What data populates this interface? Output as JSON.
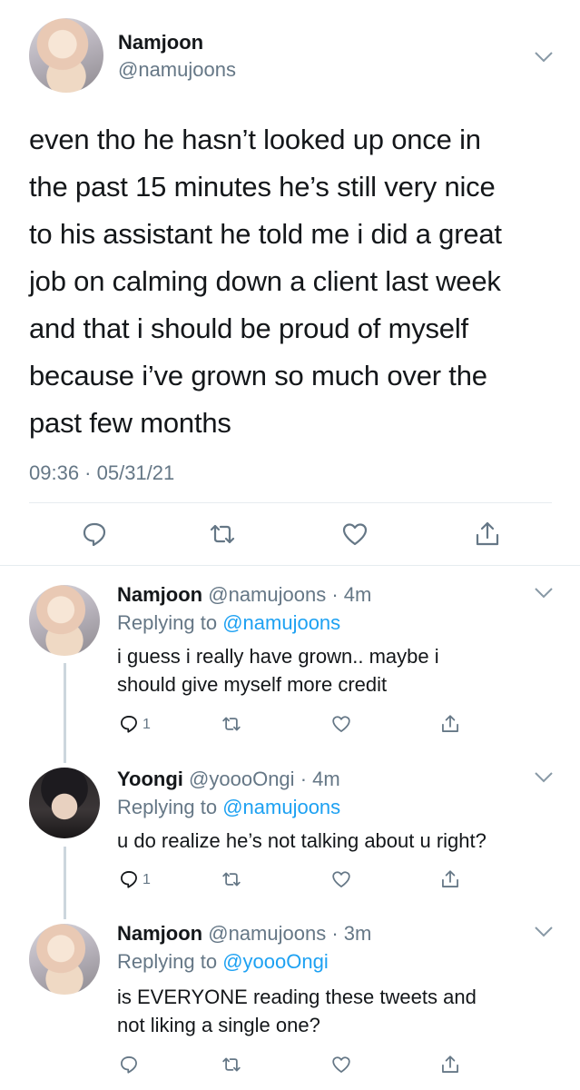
{
  "main_tweet": {
    "display_name": "Namjoon",
    "handle": "@namujoons",
    "text_lines": [
      "even tho he hasn’t looked up once in",
      "the past 15 minutes he’s still very nice",
      "to his assistant he told me i did a great",
      "job on calming down a client last week",
      "and that i should be proud of myself",
      "because i’ve grown so much over the",
      "past few months"
    ],
    "timestamp": "09:36 · 05/31/21",
    "actions": [
      "reply-icon",
      "retweet-icon",
      "like-icon",
      "share-icon"
    ]
  },
  "replies": [
    {
      "display_name": "Namjoon",
      "handle": "@namujoons",
      "time": "· 4m",
      "replying_prefix": "Replying to",
      "replying_to": "@namujoons",
      "text_lines": [
        "i guess i really have grown.. maybe i",
        "should give myself more credit"
      ],
      "reply_count": "1"
    },
    {
      "display_name": "Yoongi",
      "handle": "@yoooOngi",
      "time": "· 4m",
      "replying_prefix": "Replying to",
      "replying_to": "@namujoons",
      "text_lines": [
        "u do realize he’s not talking about u right?"
      ],
      "reply_count": "1"
    },
    {
      "display_name": "Namjoon",
      "handle": "@namujoons",
      "time": "· 3m",
      "replying_prefix": "Replying to",
      "replying_to": "@yoooOngi",
      "text_lines": [
        "is EVERYONE reading these tweets and",
        "not liking a single one?"
      ],
      "reply_count": ""
    }
  ],
  "colors": {
    "text": "#14171a",
    "secondary": "#657786",
    "link": "#1da1f2",
    "divider": "#e6ecf0"
  }
}
